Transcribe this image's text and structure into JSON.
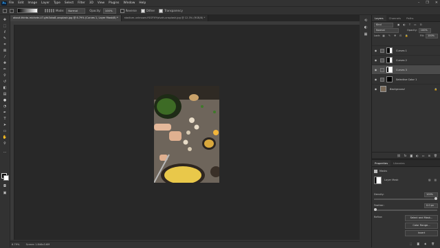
{
  "menubar": {
    "items": [
      "File",
      "Edit",
      "Image",
      "Layer",
      "Type",
      "Select",
      "Filter",
      "3D",
      "View",
      "Plugins",
      "Window",
      "Help"
    ],
    "window_controls": [
      "–",
      "❐",
      "✕"
    ]
  },
  "options": {
    "mode_label": "Mode:",
    "mode_value": "Normal",
    "opacity_label": "Opacity:",
    "opacity_value": "100%",
    "reverse_label": "Reverse",
    "dither_label": "Dither",
    "transparency_label": "Transparency"
  },
  "tabs": [
    {
      "label": "about-thinto-michele-U7-gYo3xka8-unsplash.jpg @ 6.79% (Curves 1, Layer Mask/8) *"
    },
    {
      "label": "stadium-unknown-YSGF5fYpIvah-unsplash.jpg @ 12.3% (RGB/8) *"
    }
  ],
  "status": {
    "zoom": "6.79%",
    "info": "Screen 1.846x3.6M"
  },
  "layers_panel": {
    "tabs": [
      "Layers",
      "Channels",
      "Paths"
    ],
    "filter_label": "Kind",
    "blend_mode": "Normal",
    "opacity_label": "Opacity:",
    "opacity_value": "100%",
    "lock_label": "Lock:",
    "fill_label": "Fill:",
    "fill_value": "100%",
    "layers": [
      {
        "name": "Curves 1",
        "selected": false
      },
      {
        "name": "Curves 2",
        "selected": false
      },
      {
        "name": "Curves 3",
        "selected": true
      },
      {
        "name": "Selective Color 1",
        "selected": false
      },
      {
        "name": "Background",
        "selected": false
      }
    ]
  },
  "properties_panel": {
    "tabs": [
      "Properties",
      "Libraries"
    ],
    "section": "Masks",
    "mask_type": "Layer Mask",
    "density_label": "Density:",
    "density_value": "100%",
    "feather_label": "Feather:",
    "feather_value": "0.0 px",
    "refine_label": "Refine:",
    "buttons": [
      "Select and Mask...",
      "Color Range...",
      "Invert"
    ]
  }
}
